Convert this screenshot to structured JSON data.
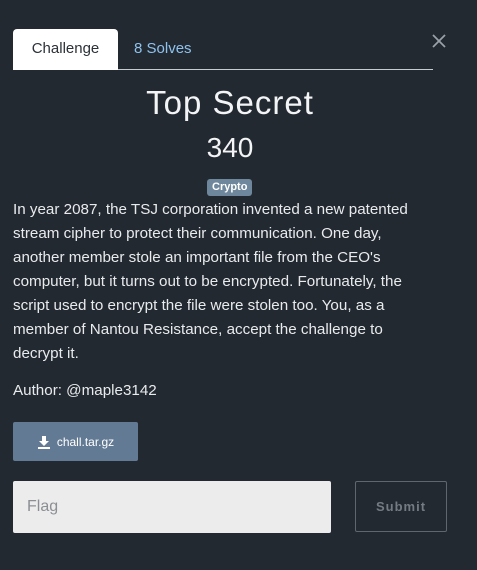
{
  "tabs": [
    {
      "label": "Challenge",
      "active": true
    },
    {
      "label": "8 Solves",
      "active": false
    }
  ],
  "challenge": {
    "title": "Top Secret",
    "points": "340",
    "category": "Crypto",
    "description_lines": [
      "In year 2087, the TSJ corporation invented a new patented",
      "stream cipher to protect their communication. One day,",
      "another member stole an important file from the CEO's",
      "computer, but it turns out to be encrypted. Fortunately, the",
      "script used to encrypt the file were stolen too. You, as a",
      "member of Nantou Resistance, accept the challenge to",
      "decrypt it."
    ],
    "author": "Author: @maple3142"
  },
  "file": {
    "label": "chall.tar.gz",
    "icon": "download-icon"
  },
  "form": {
    "flag_placeholder": "Flag",
    "flag_value": "",
    "submit_label": "Submit"
  },
  "icons": {
    "close": "close-icon"
  },
  "colors": {
    "background": "#232930",
    "tab_link": "#8ec2ee",
    "badge": "#6e879c",
    "file_button": "#627a93"
  }
}
